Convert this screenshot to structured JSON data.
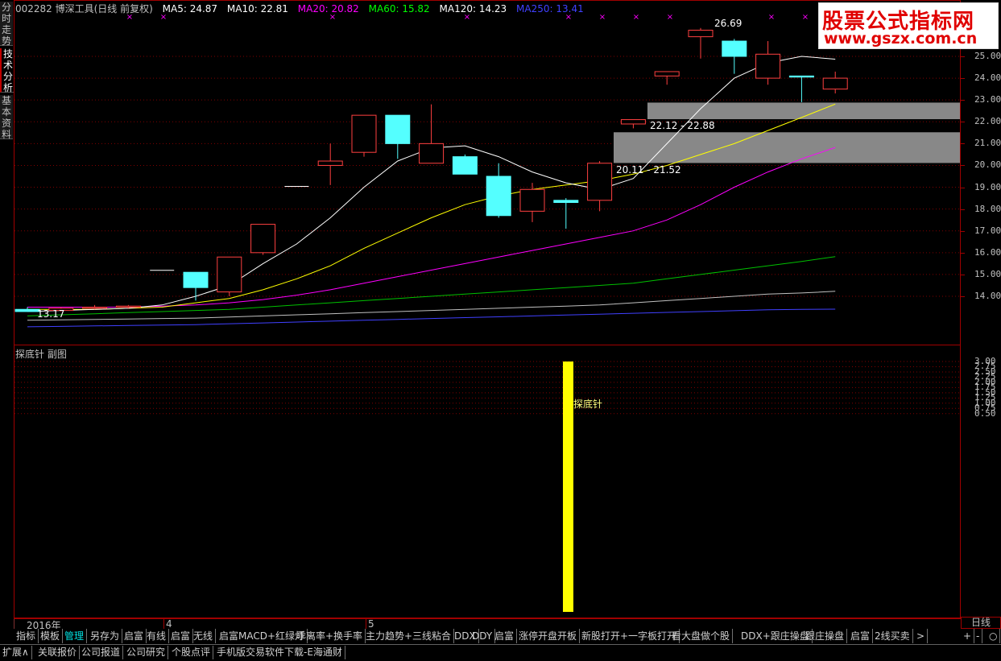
{
  "side_tabs": [
    {
      "label": "分时走势"
    },
    {
      "label": "技术分析"
    },
    {
      "label": "基本资料"
    }
  ],
  "header": {
    "stock": "002282 博深工具(日线 前复权)",
    "ma5": "MA5: 24.87",
    "ma10": "MA10: 22.81",
    "ma20": "MA20: 20.82",
    "ma60": "MA60: 15.82",
    "ma120": "MA120: 14.23",
    "ma250": "MA250: 13.41"
  },
  "colors": {
    "ma5": "#ffffff",
    "ma10": "#ffff00",
    "ma20": "#ff00ff",
    "ma60": "#00c000",
    "ma120": "#c0c0c0",
    "ma250": "#4040ff",
    "up": "#ff4040",
    "down": "#54ffff",
    "grid": "#800000"
  },
  "price_axis": [
    "25.00",
    "24.00",
    "23.00",
    "22.00",
    "21.00",
    "20.00",
    "19.00",
    "18.00",
    "17.00",
    "16.00",
    "15.00",
    "14.00"
  ],
  "annotations": {
    "high": "26.69",
    "low": "13.17",
    "zone_upper": "22.12 - 22.88",
    "zone_lower": "20.11 - 21.52"
  },
  "candles": [
    {
      "o": 13.4,
      "h": 13.5,
      "l": 13.3,
      "c": 13.3
    },
    {
      "o": 13.35,
      "h": 13.5,
      "l": 13.3,
      "c": 13.45
    },
    {
      "o": 13.45,
      "h": 13.6,
      "l": 13.4,
      "c": 13.5
    },
    {
      "o": 13.5,
      "h": 13.6,
      "l": 13.45,
      "c": 13.55
    },
    {
      "o": 15.19,
      "h": 15.19,
      "l": 15.19,
      "c": 15.19
    },
    {
      "o": 15.1,
      "h": 15.1,
      "l": 13.8,
      "c": 14.4
    },
    {
      "o": 14.2,
      "h": 15.8,
      "l": 14.0,
      "c": 15.8
    },
    {
      "o": 16.0,
      "h": 17.3,
      "l": 15.9,
      "c": 17.3
    },
    {
      "o": 19.04,
      "h": 19.04,
      "l": 19.04,
      "c": 19.04
    },
    {
      "o": 20.0,
      "h": 21.0,
      "l": 19.1,
      "c": 20.2
    },
    {
      "o": 20.6,
      "h": 22.3,
      "l": 20.4,
      "c": 22.3
    },
    {
      "o": 22.3,
      "h": 22.3,
      "l": 20.3,
      "c": 21.0
    },
    {
      "o": 20.1,
      "h": 22.8,
      "l": 20.1,
      "c": 21.0
    },
    {
      "o": 20.4,
      "h": 20.5,
      "l": 19.6,
      "c": 19.6
    },
    {
      "o": 19.5,
      "h": 20.1,
      "l": 17.6,
      "c": 17.7
    },
    {
      "o": 17.9,
      "h": 19.2,
      "l": 17.4,
      "c": 18.9
    },
    {
      "o": 18.4,
      "h": 18.5,
      "l": 17.1,
      "c": 18.3
    },
    {
      "o": 18.4,
      "h": 20.2,
      "l": 17.9,
      "c": 20.1
    },
    {
      "o": 21.9,
      "h": 22.1,
      "l": 21.7,
      "c": 22.1
    },
    {
      "o": 24.1,
      "h": 24.3,
      "l": 23.7,
      "c": 24.3
    },
    {
      "o": 25.9,
      "h": 26.3,
      "l": 24.9,
      "c": 26.2
    },
    {
      "o": 25.7,
      "h": 25.8,
      "l": 24.2,
      "c": 25.0
    },
    {
      "o": 24.0,
      "h": 25.7,
      "l": 23.7,
      "c": 25.1
    },
    {
      "o": 24.1,
      "h": 24.1,
      "l": 22.9,
      "c": 24.05
    },
    {
      "o": 23.5,
      "h": 24.3,
      "l": 23.3,
      "c": 24.0
    }
  ],
  "ma5_line": [
    13.3,
    13.35,
    13.4,
    13.45,
    13.6,
    14.0,
    14.5,
    15.5,
    16.4,
    17.6,
    19.0,
    20.2,
    20.8,
    20.9,
    20.4,
    19.7,
    19.2,
    18.9,
    19.4,
    21.0,
    22.6,
    24.0,
    24.7,
    25.0,
    24.87
  ],
  "ma10_line": [
    13.4,
    13.4,
    13.4,
    13.45,
    13.5,
    13.7,
    13.9,
    14.3,
    14.8,
    15.4,
    16.2,
    16.9,
    17.6,
    18.2,
    18.6,
    18.9,
    19.1,
    19.3,
    19.6,
    20.0,
    20.5,
    21.0,
    21.6,
    22.2,
    22.81
  ],
  "ma20_line": [
    13.5,
    13.5,
    13.5,
    13.5,
    13.55,
    13.6,
    13.7,
    13.85,
    14.05,
    14.3,
    14.6,
    14.9,
    15.2,
    15.5,
    15.8,
    16.1,
    16.4,
    16.7,
    17.0,
    17.5,
    18.2,
    19.0,
    19.7,
    20.3,
    20.82
  ],
  "ma60_line": [
    13.1,
    13.15,
    13.2,
    13.25,
    13.3,
    13.35,
    13.4,
    13.5,
    13.6,
    13.7,
    13.8,
    13.9,
    14.0,
    14.1,
    14.2,
    14.3,
    14.4,
    14.5,
    14.6,
    14.8,
    15.0,
    15.2,
    15.4,
    15.6,
    15.82
  ],
  "ma120_line": [
    12.9,
    12.92,
    12.94,
    12.96,
    12.98,
    13.0,
    13.05,
    13.1,
    13.15,
    13.2,
    13.25,
    13.3,
    13.35,
    13.4,
    13.45,
    13.5,
    13.55,
    13.6,
    13.7,
    13.8,
    13.9,
    14.0,
    14.1,
    14.15,
    14.23
  ],
  "ma250_line": [
    12.6,
    12.62,
    12.64,
    12.66,
    12.68,
    12.7,
    12.74,
    12.78,
    12.82,
    12.86,
    12.9,
    12.94,
    12.98,
    13.02,
    13.06,
    13.1,
    13.14,
    13.18,
    13.22,
    13.26,
    13.3,
    13.34,
    13.38,
    13.4,
    13.41
  ],
  "indicator": {
    "title": "探底针 副图",
    "signal_label": "探底针",
    "axis": [
      "3.00",
      "2.75",
      "2.50",
      "2.25",
      "2.00",
      "1.75",
      "1.50",
      "1.25",
      "1.00",
      "0.75",
      "0.50"
    ],
    "signal_value": 3.0,
    "signal_index": 16
  },
  "date_axis": {
    "year": "2016年",
    "m4": "4",
    "m5": "5"
  },
  "period": "日线",
  "toolbar": [
    "指标",
    "模板",
    "管理",
    "另存为",
    "启富",
    "有线",
    "启富",
    "无线",
    "启富MACD+红绿灯",
    "乖离率+换手率",
    "主力趋势+三线粘合",
    "DDX",
    "DDY",
    "启富",
    "涨停开盘开板",
    "新股打开+一字板打开",
    "看大盘做个股",
    "DDX+跟庄操盘",
    "跟庄操盘",
    "启富",
    "2线买卖",
    ">"
  ],
  "toolbar_right": [
    "+",
    "-",
    "○"
  ],
  "statusbar": [
    "扩展∧",
    "关联报价",
    "公司报道",
    "公司研究",
    "个股点评",
    "手机版交易软件下载-E海通财"
  ],
  "watermark": {
    "line1": "股票公式指标网",
    "line2": "www.gszx.com.cn"
  }
}
